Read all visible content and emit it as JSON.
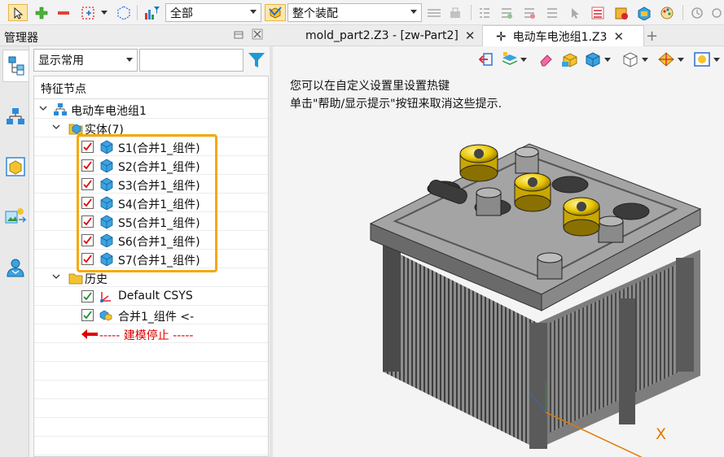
{
  "toolbar": {
    "filter_value": "全部",
    "assembly_value": "整个装配"
  },
  "manager": {
    "title": "管理器",
    "display_select": "显示常用",
    "search_placeholder": "",
    "tree_header": "特征节点"
  },
  "tree": {
    "root": "电动车电池组1",
    "solid_group": "实体(7)",
    "solids": [
      "S1(合并1_组件)",
      "S2(合并1_组件)",
      "S3(合并1_组件)",
      "S4(合并1_组件)",
      "S5(合并1_组件)",
      "S6(合并1_组件)",
      "S7(合并1_组件)"
    ],
    "history_group": "历史",
    "history": [
      "Default CSYS",
      "合并1_组件 <-"
    ],
    "stop_marker": "----- 建模停止 -----"
  },
  "tabs": [
    {
      "label": "mold_part2.Z3 - [zw-Part2]",
      "active": false
    },
    {
      "label": "电动车电池组1.Z3",
      "active": true
    }
  ],
  "viewport": {
    "hint_line1": "您可以在自定义设置里设置热键",
    "hint_line2": "单击\"帮助/显示提示\"按钮来取消这些提示.",
    "axis_x": "X"
  },
  "colors": {
    "accent": "#f5a80a",
    "check": "#e00000",
    "stop": "#e00000",
    "filter": "#1e9ad6"
  }
}
